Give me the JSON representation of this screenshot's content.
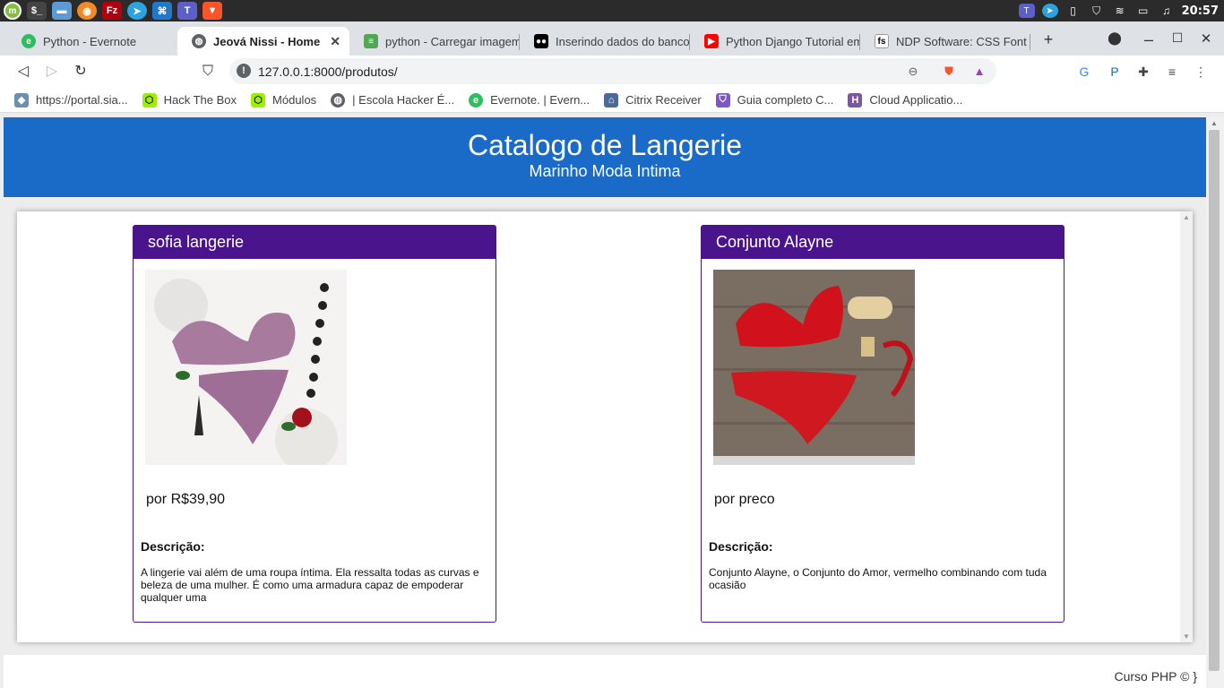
{
  "taskbar": {
    "apps": [
      "mint-menu-icon",
      "terminal-icon",
      "files-icon",
      "firefox-icon",
      "filezilla-icon",
      "telegram-icon",
      "vscode-icon",
      "teams-icon",
      "brave-icon"
    ],
    "clock": "20:57"
  },
  "tabs": [
    {
      "title": "Python - Evernote",
      "icon": "evernote-icon"
    },
    {
      "title": "Jeová Nissi - Home",
      "icon": "globe-icon"
    },
    {
      "title": "python - Carregar imagem",
      "icon": "stackoverflow-icon"
    },
    {
      "title": "Inserindo dados do banco",
      "icon": "medium-icon"
    },
    {
      "title": "Python Django Tutorial em",
      "icon": "youtube-icon"
    },
    {
      "title": "NDP Software: CSS Font S",
      "icon": "ndp-icon"
    }
  ],
  "toolbar": {
    "url": "127.0.0.1:8000/produtos/"
  },
  "bookmarks": [
    {
      "label": "https://portal.sia...",
      "icon": "cube-icon"
    },
    {
      "label": "Hack The Box",
      "icon": "htb-icon"
    },
    {
      "label": "Módulos",
      "icon": "htb-icon"
    },
    {
      "label": "| Escola Hacker É...",
      "icon": "globe-icon"
    },
    {
      "label": "Evernote. | Evern...",
      "icon": "evernote-icon"
    },
    {
      "label": "Citrix Receiver",
      "icon": "lock-icon"
    },
    {
      "label": "Guia completo C...",
      "icon": "shield-icon"
    },
    {
      "label": "Cloud Applicatio...",
      "icon": "heroku-icon"
    }
  ],
  "header": {
    "title": "Catalogo de Langerie",
    "subtitle": "Marinho Moda Intima"
  },
  "products": [
    {
      "name": "sofia langerie",
      "price": "por R$39,90",
      "desc_label": "Descrição:",
      "description": "A lingerie vai além de uma roupa íntima. Ela ressalta todas as curvas e beleza de uma mulher. É como uma armadura capaz de empoderar qualquer uma"
    },
    {
      "name": "Conjunto Alayne",
      "price": "por preco",
      "desc_label": "Descrição:",
      "description": "Conjunto Alayne, o Conjunto do Amor, vermelho combinando com tuda ocasião"
    }
  ],
  "footer": {
    "text": "Curso PHP © }"
  },
  "colors": {
    "header_bg": "#1a6ac7",
    "card_accent": "#4a148c"
  }
}
